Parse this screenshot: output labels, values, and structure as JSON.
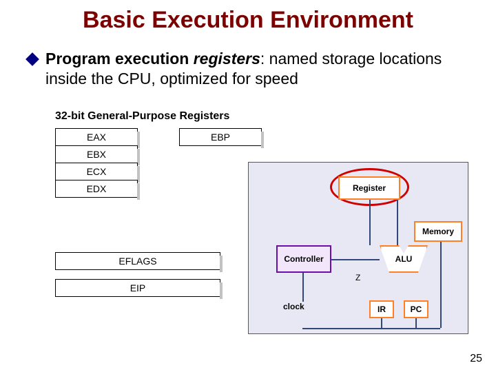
{
  "title": "Basic Execution Environment",
  "bullet": {
    "strong": "Program execution ",
    "emph": "registers",
    "rest": ": named storage locations inside the CPU, optimized for speed"
  },
  "figure": {
    "heading": "32-bit General-Purpose Registers",
    "left_col": [
      "EAX",
      "EBX",
      "ECX",
      "EDX"
    ],
    "right_col": [
      "EBP"
    ],
    "flags": "EFLAGS",
    "eip": "EIP"
  },
  "cpu": {
    "register": "Register",
    "memory": "Memory",
    "controller": "Controller",
    "alu": "ALU",
    "ir": "IR",
    "pc": "PC",
    "clock": "clock",
    "z": "Z"
  },
  "page_number": "25"
}
